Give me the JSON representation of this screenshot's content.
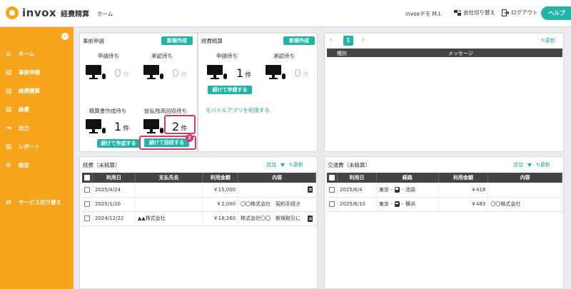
{
  "header": {
    "logo_word": "invox",
    "logo_sub": "経費精算",
    "home_link": "ホーム",
    "user_name": "invoxデモ M.I.",
    "switch_company": "会社切り替え",
    "logout": "ログアウト",
    "help": "ヘルプ"
  },
  "sidebar": {
    "items": [
      {
        "label": "ホーム",
        "icon": "home-icon"
      },
      {
        "label": "事前申請",
        "icon": "document-icon"
      },
      {
        "label": "経費精算",
        "icon": "document-icon"
      },
      {
        "label": "経費",
        "icon": "document-icon"
      },
      {
        "label": "出力",
        "icon": "export-icon"
      },
      {
        "label": "レポート",
        "icon": "chart-icon"
      },
      {
        "label": "設定",
        "icon": "gear-icon"
      },
      {
        "label": "サービス切り替え",
        "icon": "switch-icon"
      }
    ]
  },
  "pre_application": {
    "title": "事前申請",
    "new_button": "新規作成",
    "stats": [
      {
        "label": "申請待ち",
        "count": "0",
        "unit": "件"
      },
      {
        "label": "承認待ち",
        "count": "0",
        "unit": "件"
      },
      {
        "label": "精算書作成待ち",
        "count": "1",
        "unit": "件"
      },
      {
        "label": "仮払残高回収待ち",
        "count": "2",
        "unit": "件"
      }
    ],
    "continue_create": "続けて作成する",
    "continue_collect": "続けて回収する",
    "badge": "2"
  },
  "expense_settlement": {
    "title": "経費精算",
    "new_button": "新規作成",
    "stats": [
      {
        "label": "申請待ち",
        "count": "1",
        "unit": "件"
      },
      {
        "label": "承認待ち",
        "count": "0",
        "unit": "件"
      }
    ],
    "continue_apply": "続けて申請する",
    "mobile_link": "モバイルアプリを利用する"
  },
  "messages": {
    "page": "1",
    "refresh": "更新",
    "columns": [
      "種別",
      "メッセージ"
    ]
  },
  "expenses": {
    "title": "経費（未精算）",
    "add": "追加",
    "refresh": "更新",
    "columns": [
      "利用日",
      "支払先名",
      "利用金額",
      "内容"
    ],
    "rows": [
      {
        "date": "2025/4/24",
        "payee": "",
        "amount": "￥15,000",
        "content": ""
      },
      {
        "date": "2025/1/20",
        "payee": "",
        "amount": "￥2,000",
        "content": "〇〇株式会社　契約手続き"
      },
      {
        "date": "2024/12/22",
        "payee": "▲▲株式会社",
        "amount": "￥18,260",
        "content": "株式会社〇〇　新規取引に"
      }
    ]
  },
  "transport": {
    "title": "交通費（未精算）",
    "add": "追加",
    "refresh": "更新",
    "columns": [
      "利用日",
      "経路",
      "利用金額",
      "内容"
    ],
    "rows": [
      {
        "date": "2025/6/4",
        "from": "東京",
        "to": "池袋",
        "amount": "￥418",
        "content": ""
      },
      {
        "date": "2025/6/10",
        "from": "東京",
        "to": "横浜",
        "amount": "￥483",
        "content": "〇〇株式会社"
      }
    ]
  },
  "colors": {
    "brand_orange": "#f8a41c",
    "accent_teal": "#22b5a6",
    "highlight_pink": "#e0356b"
  }
}
